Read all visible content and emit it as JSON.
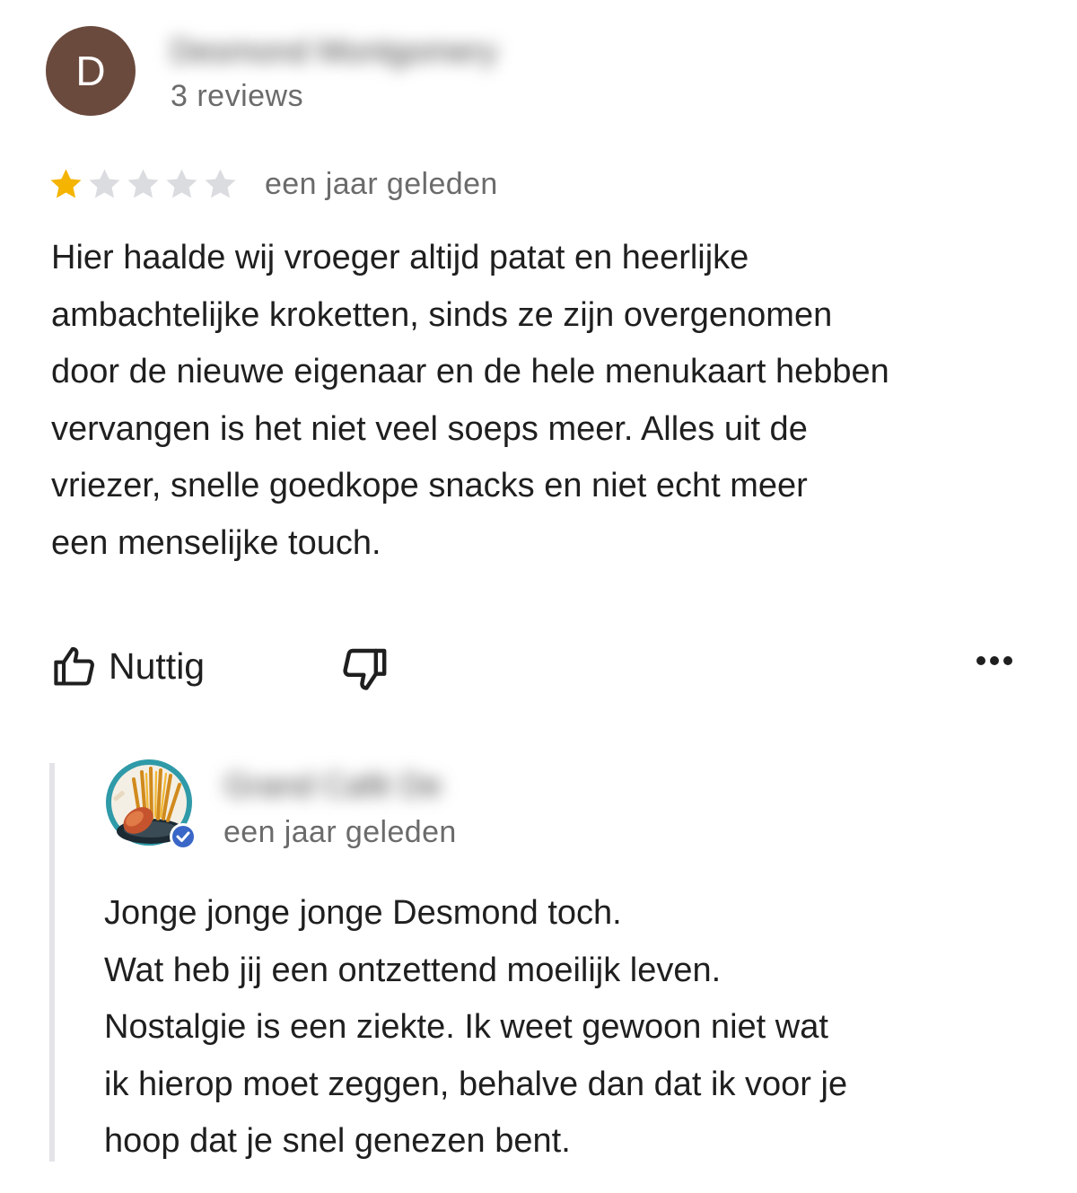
{
  "review": {
    "avatar_initial": "D",
    "author_name": "Desmond Montgomery",
    "review_count": "3 reviews",
    "rating": 1,
    "max_rating": 5,
    "date": "een jaar geleden",
    "text_lines": [
      "Hier haalde wij vroeger altijd patat en heerlijke",
      "ambachtelijke kroketten, sinds ze zijn overgenomen",
      "door de nieuwe eigenaar en de hele menukaart hebben",
      "vervangen is het niet veel soeps meer. Alles uit de",
      "vriezer, snelle goedkope snacks en niet echt meer",
      "een menselijke touch."
    ]
  },
  "actions": {
    "useful_label": "Nuttig",
    "useful_icon": "thumbs-up-icon",
    "dislike_icon": "thumbs-down-icon",
    "more_icon": "more-options-icon"
  },
  "owner_reply": {
    "owner_name": "Grand Café De",
    "date": "een jaar geleden",
    "verified_icon": "verified-badge-icon",
    "text_lines": [
      "Jonge jonge jonge Desmond toch.",
      "Wat heb jij een ontzettend moeilijk leven.",
      "Nostalgie is een ziekte. Ik weet gewoon niet wat",
      "ik hierop moet zeggen, behalve dan dat ik voor je",
      "hoop dat je snel genezen bent."
    ]
  },
  "colors": {
    "star_filled": "#f4b400",
    "star_empty": "#dadce0",
    "avatar_bg": "#6b4a3e",
    "verified_badge": "#1a73e8"
  }
}
